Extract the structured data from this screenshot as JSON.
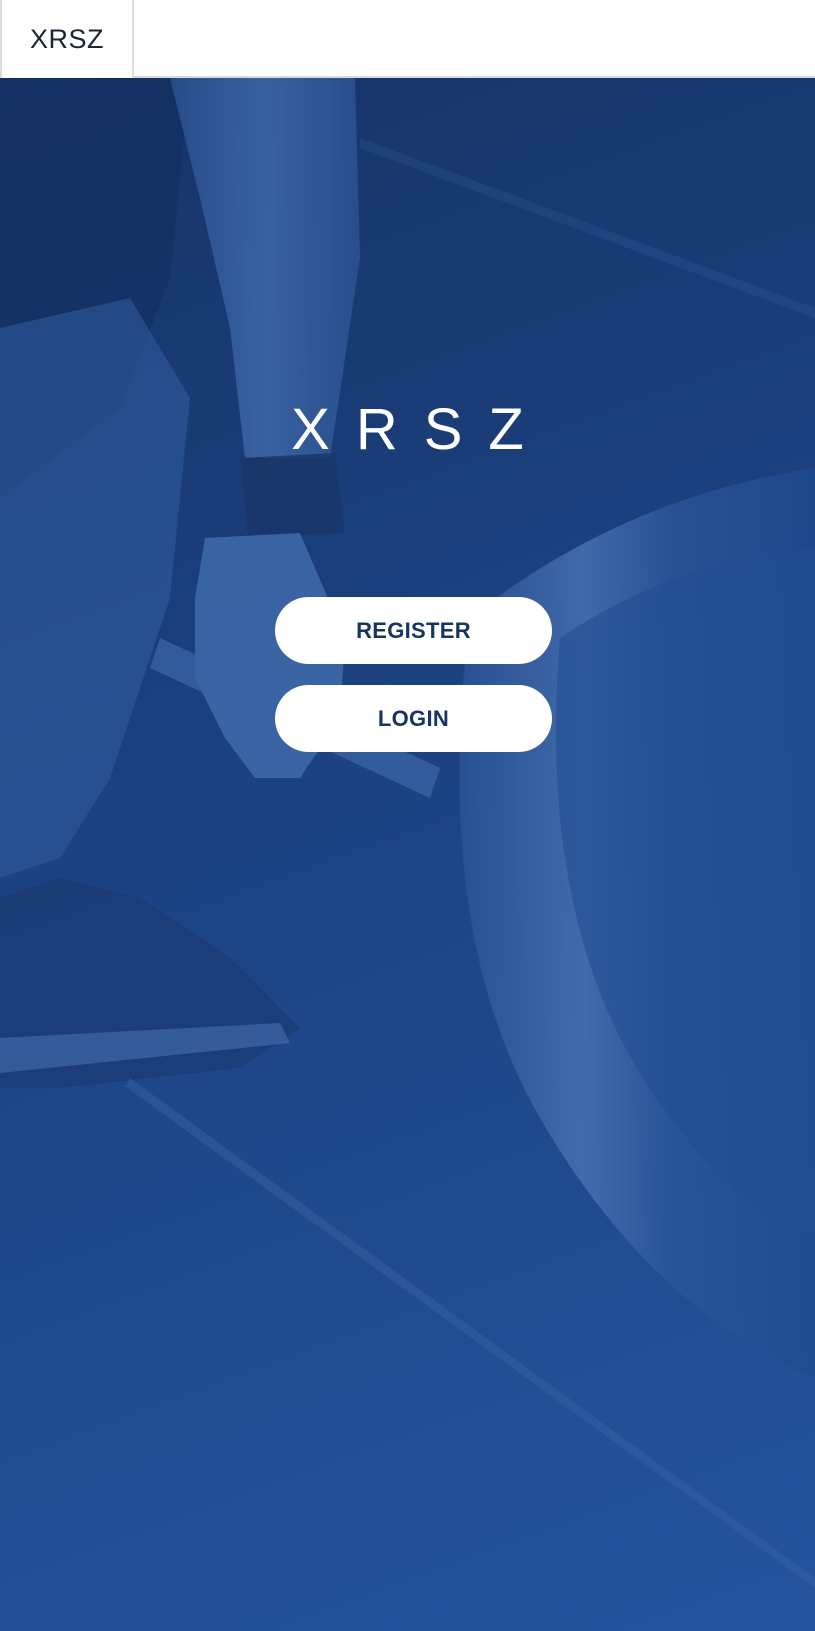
{
  "header": {
    "brand": "XRSZ"
  },
  "hero": {
    "logo_text": "XRSZ"
  },
  "actions": {
    "register_label": "REGISTER",
    "login_label": "LOGIN"
  },
  "colors": {
    "primary_blue": "#1f4a8f",
    "button_text": "#183463",
    "button_bg": "#ffffff"
  }
}
